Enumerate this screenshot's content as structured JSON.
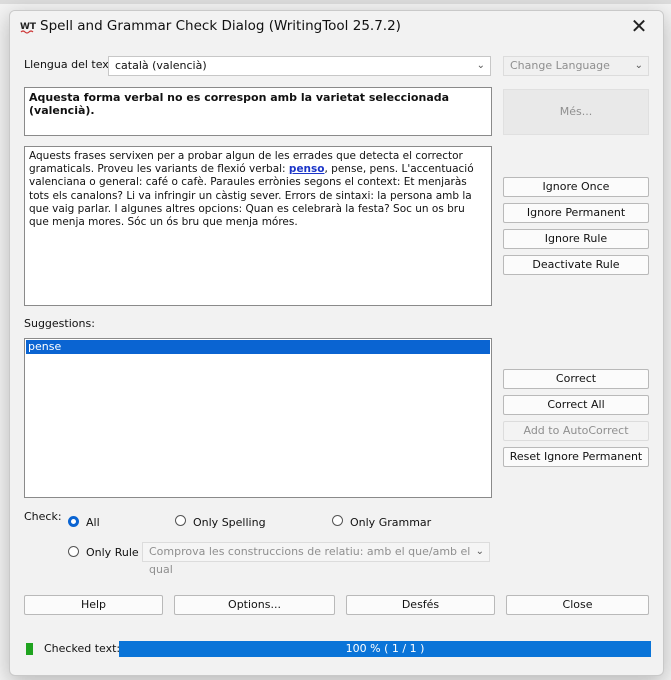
{
  "window": {
    "title": "Spell and Grammar Check Dialog (WritingTool 25.7.2)",
    "close_glyph": "✕"
  },
  "language": {
    "label": "Llengua del text:",
    "selected": "català (valencià)",
    "change_language": "Change Language"
  },
  "message": "Aquesta forma verbal no es correspon amb la varietat seleccionada (valencià).",
  "more_button": "Més...",
  "text": {
    "before": "Aquests frases servixen per a probar algun de les errades que detecta el corrector gramaticals. Proveu les variants de flexió verbal: ",
    "error_word": "penso",
    "after": ", pense, pens. L'accentuació valenciana o general: café o cafè. Paraules errònies segons el context: Et menjaràs tots els canalons? Li va infringir un càstig sever. Errors de sintaxi: la persona amb la que vaig parlar. I algunes altres opcions: Quan es celebrarà la festa? Soc un os bru que menja mores. Sóc un ós bru que menja móres."
  },
  "actions_top": {
    "ignore_once": "Ignore Once",
    "ignore_permanent": "Ignore Permanent",
    "ignore_rule": "Ignore Rule",
    "deactivate_rule": "Deactivate Rule"
  },
  "suggestions": {
    "label": "Suggestions:",
    "items": [
      "pense"
    ]
  },
  "actions_bottom": {
    "correct": "Correct",
    "correct_all": "Correct All",
    "add_autocorrect": "Add to AutoCorrect",
    "reset_ignore": "Reset Ignore Permanent"
  },
  "check": {
    "label": "Check:",
    "all": "All",
    "only_spelling": "Only Spelling",
    "only_grammar": "Only Grammar",
    "only_rule": "Only Rule",
    "rule_selected": "Comprova les construccions de relatiu: amb el que/amb el qual"
  },
  "footer": {
    "help": "Help",
    "options": "Options...",
    "undo": "Desfés",
    "close": "Close"
  },
  "status": {
    "label": "Checked text:",
    "progress_text": "100 %  ( 1 / 1 )",
    "progress_value": 1.0
  },
  "colors": {
    "accent": "#0a64d2",
    "progress": "#0a74d8",
    "status_ok": "#1fa31f",
    "error_word": "#1a34c8"
  }
}
